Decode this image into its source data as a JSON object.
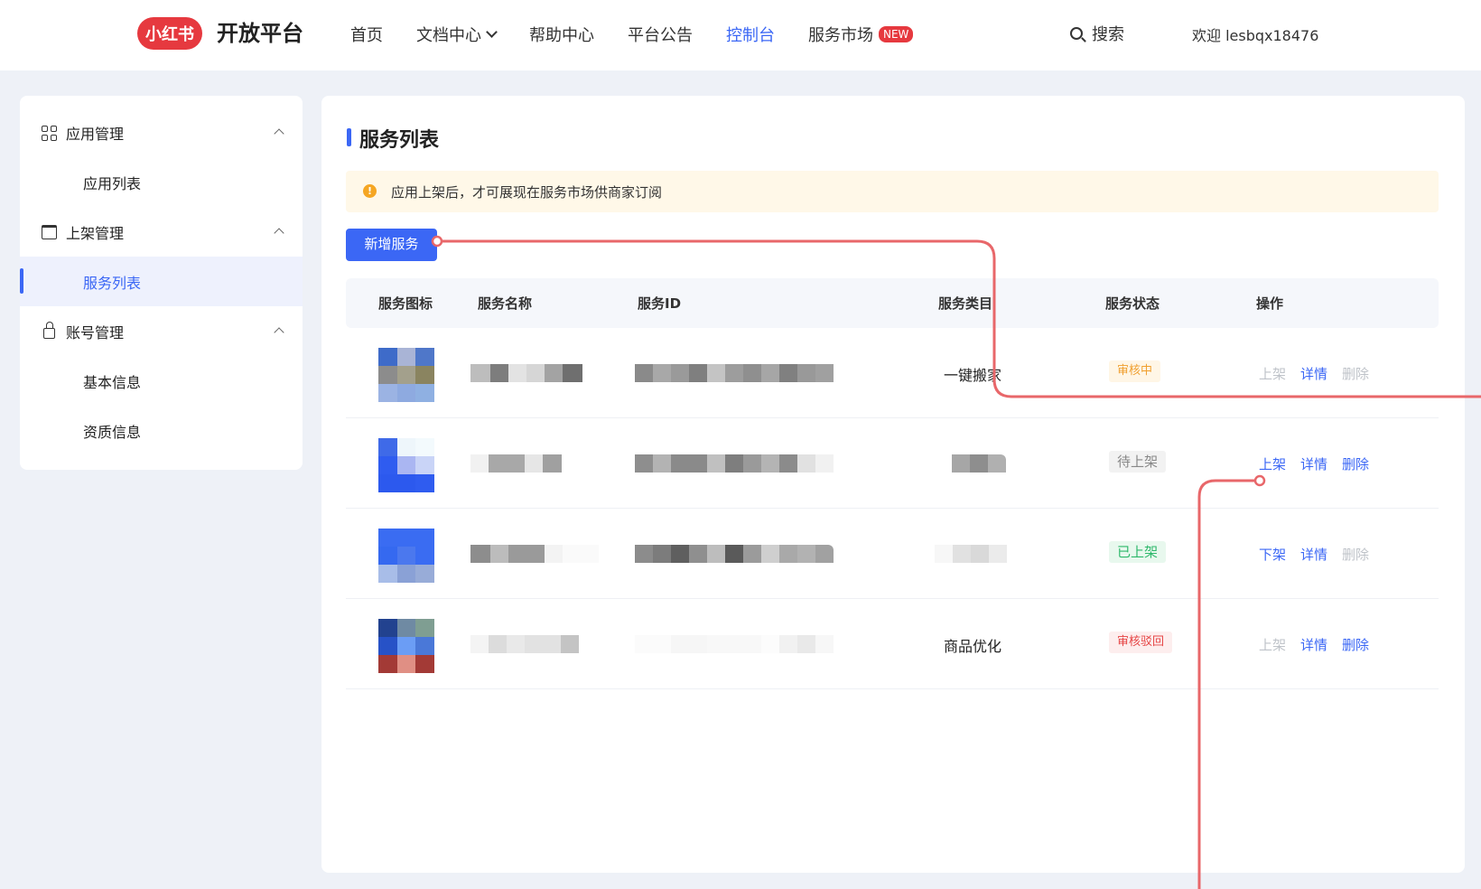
{
  "header": {
    "logo_text": "小红书",
    "brand": "开放平台",
    "nav": [
      {
        "label": "首页"
      },
      {
        "label": "文档中心"
      },
      {
        "label": "帮助中心"
      },
      {
        "label": "平台公告"
      },
      {
        "label": "控制台"
      },
      {
        "label": "服务市场"
      }
    ],
    "active_nav": "控制台",
    "new_badge": "NEW",
    "search_label": "搜索",
    "welcome": "欢迎 lesbqx18476"
  },
  "sidebar": {
    "groups": [
      {
        "label": "应用管理",
        "icon": "grid-icon",
        "items": [
          "应用列表"
        ]
      },
      {
        "label": "上架管理",
        "icon": "store-icon",
        "items": [
          "服务列表"
        ]
      },
      {
        "label": "账号管理",
        "icon": "lock-icon",
        "items": [
          "基本信息",
          "资质信息"
        ]
      }
    ],
    "active_item": "服务列表"
  },
  "main": {
    "title": "服务列表",
    "notice": "应用上架后，才可展现在服务市场供商家订阅",
    "add_button": "新增服务",
    "columns": [
      "服务图标",
      "服务名称",
      "服务ID",
      "服务类目",
      "服务状态",
      "操作"
    ],
    "rows": [
      {
        "category": "一键搬家",
        "status": "审核中",
        "ops": [
          "上架",
          "详情",
          "删除"
        ]
      },
      {
        "category": "",
        "status": "待上架",
        "ops": [
          "上架",
          "详情",
          "删除"
        ]
      },
      {
        "category": "",
        "status": "已上架",
        "ops": [
          "下架",
          "详情",
          "删除"
        ]
      },
      {
        "category": "商品优化",
        "status": "审核驳回",
        "ops": [
          "上架",
          "详情",
          "删除"
        ]
      }
    ]
  },
  "colors": {
    "accent": "#3b67f5",
    "brand_red": "#e6393f",
    "annotation_line": "#e8676a"
  }
}
